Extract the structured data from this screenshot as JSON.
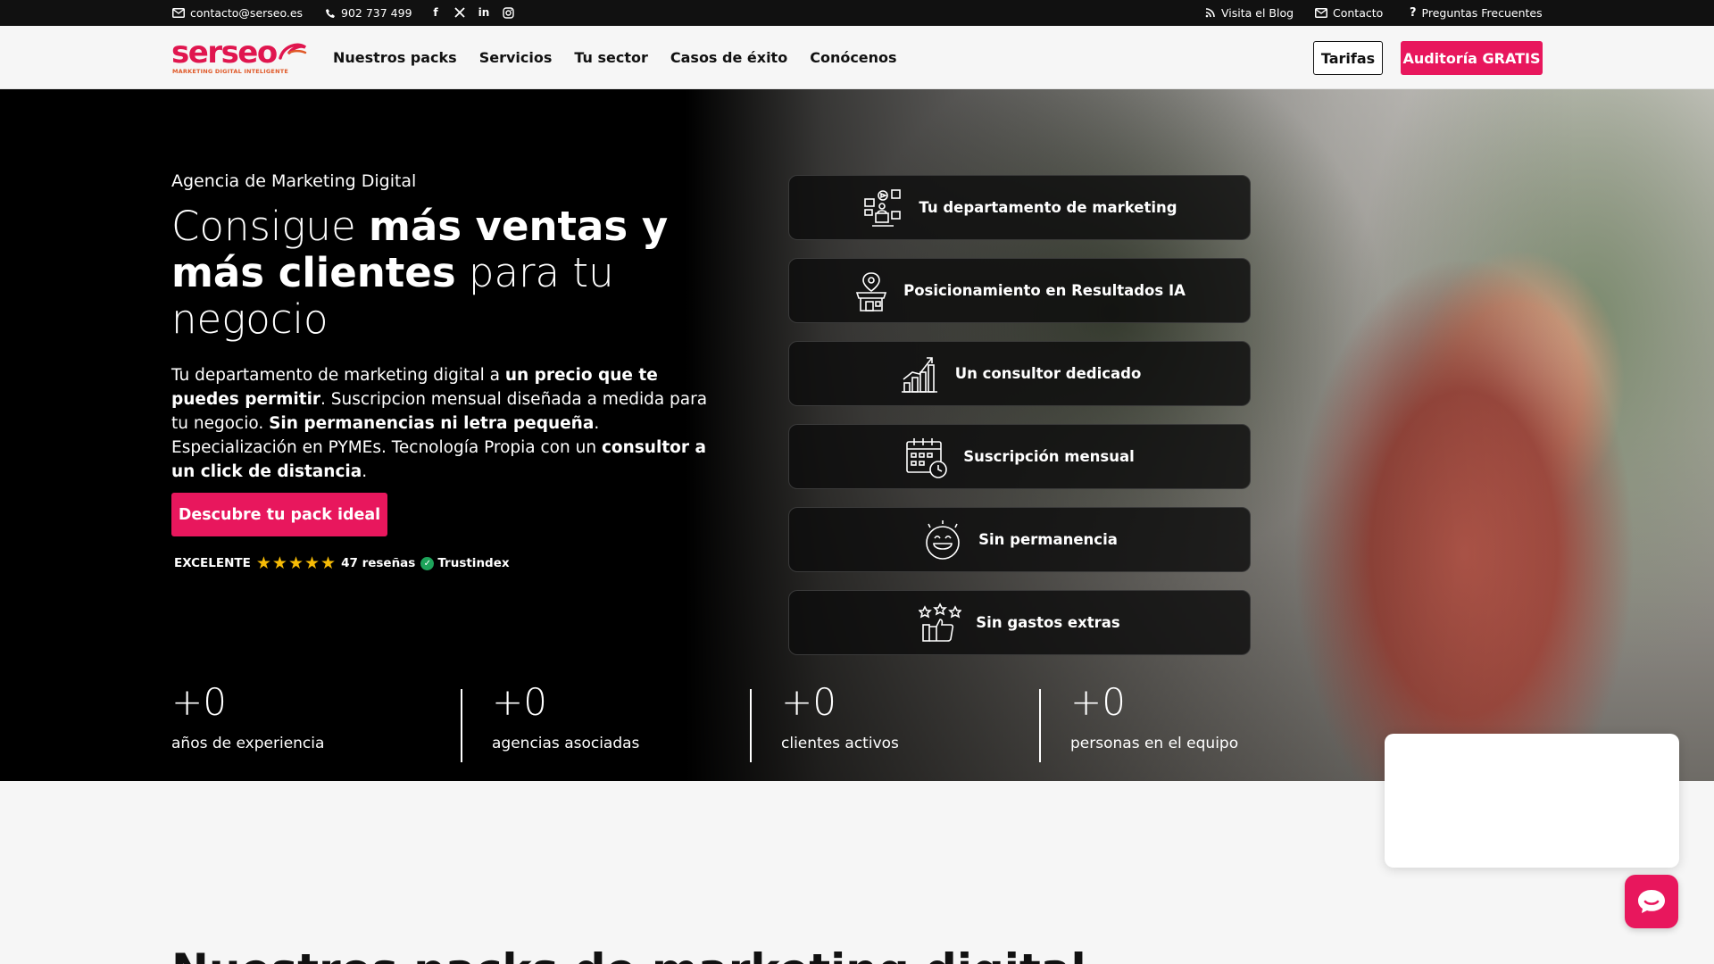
{
  "topbar": {
    "email": "contacto@serseo.es",
    "phone": "902 737 499",
    "social_icons": [
      "facebook-icon",
      "x-twitter-icon",
      "linkedin-icon",
      "instagram-icon"
    ],
    "blog": "Visita el Blog",
    "contact": "Contacto",
    "faq": "Preguntas Frecuentes"
  },
  "header": {
    "logo_text": "serseo",
    "logo_tagline": "MARKETING DIGITAL INTELIGENTE",
    "nav": [
      "Nuestros packs",
      "Servicios",
      "Tu sector",
      "Casos de éxito",
      "Conócenos"
    ],
    "tarifas": "Tarifas",
    "audit": "Auditoría GRATIS"
  },
  "hero": {
    "subtitle": "Agencia de Marketing Digital",
    "title_parts": [
      "Consigue ",
      "más ventas y más clientes",
      " para tu negocio"
    ],
    "desc_parts": [
      "Tu departamento de marketing digital a ",
      "un precio que te puedes permitir",
      ". Suscripcion mensual diseñada a medida para tu negocio. ",
      "Sin permanencias ni letra pequeña",
      ". Especialización en PYMEs. Tecnología Propia con un ",
      "consultor a un click de distancia",
      "."
    ],
    "cta": "Descubre tu pack ideal",
    "rating": {
      "label": "EXCELENTE",
      "stars": 5,
      "reviews": "47 reseñas",
      "provider": "Trustindex"
    }
  },
  "features": [
    {
      "label": "Tu departamento de marketing",
      "icon": "marketing-department-icon"
    },
    {
      "label": "Posicionamiento en Resultados IA",
      "icon": "location-store-icon"
    },
    {
      "label": "Un consultor dedicado",
      "icon": "growth-chart-icon"
    },
    {
      "label": "Suscripción mensual",
      "icon": "calendar-clock-icon"
    },
    {
      "label": "Sin permanencia",
      "icon": "happy-face-icon"
    },
    {
      "label": "Sin gastos extras",
      "icon": "thumbs-up-stars-icon"
    }
  ],
  "stats": [
    {
      "value": "+0",
      "label": "años de experiencia"
    },
    {
      "value": "+0",
      "label": "agencias asociadas"
    },
    {
      "value": "+0",
      "label": "clientes activos"
    },
    {
      "value": "+0",
      "label": "personas en el equipo"
    }
  ],
  "section": {
    "title": "Nuestros packs de marketing digital"
  },
  "colors": {
    "brand": "#e8175d",
    "dark": "#111111",
    "star": "#f6bb06"
  }
}
